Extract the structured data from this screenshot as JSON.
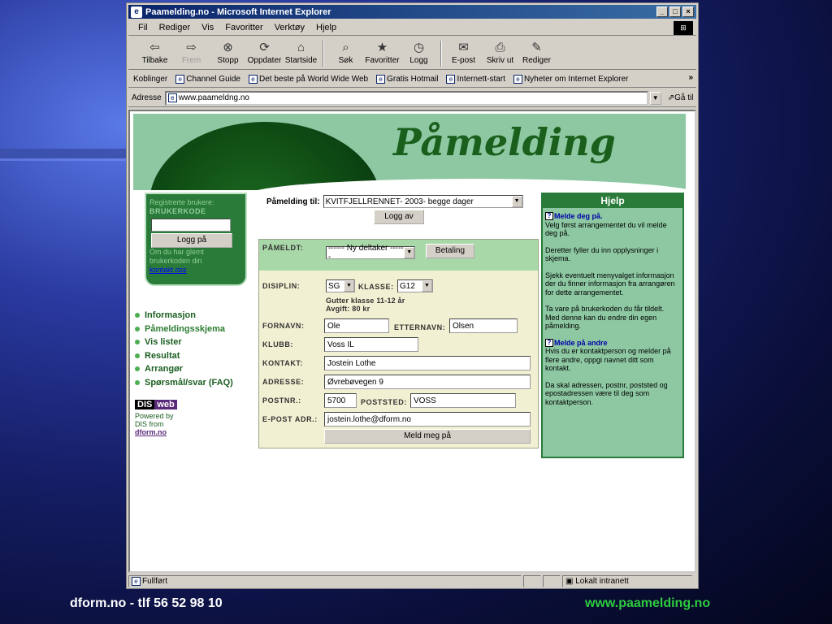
{
  "window": {
    "title": "Paamelding.no - Microsoft Internet Explorer",
    "buttons": [
      "_",
      "□",
      "×"
    ],
    "logo_icon": "windows-logo-icon"
  },
  "menu": [
    "Fil",
    "Rediger",
    "Vis",
    "Favoritter",
    "Verktøy",
    "Hjelp"
  ],
  "toolbar": {
    "back": "Tilbake",
    "forward": "Frem",
    "stop": "Stopp",
    "refresh": "Oppdater",
    "home": "Startside",
    "search": "Søk",
    "favorites": "Favoritter",
    "history": "Logg",
    "mail": "E-post",
    "print": "Skriv ut",
    "edit": "Rediger"
  },
  "links": {
    "label": "Koblinger",
    "items": [
      "Channel Guide",
      "Det beste på World Wide Web",
      "Gratis Hotmail",
      "Internett-start",
      "Nyheter om Internet Explorer"
    ]
  },
  "address": {
    "label": "Adresse",
    "value": "www.paameldng.no",
    "go": "Gå til"
  },
  "page": {
    "title": "Påmelding",
    "login": {
      "registered": "Registrerte brukere:",
      "code_label": "BRUKERKODE",
      "button": "Logg på",
      "forgot": "Om du har glemt brukerkoden din",
      "contact": "kontakt oss"
    },
    "nav": [
      "Informasjon",
      "Påmeldingsskjema",
      "Vis lister",
      "Resultat",
      "Arrangør",
      "Spørsmål/svar (FAQ)"
    ],
    "dis": {
      "logo_left": "DIS",
      "logo_right": "web",
      "powered": "Powered by",
      "from": "DIS from",
      "link": "dform.no"
    },
    "registration": {
      "label": "Påmelding til:",
      "event": "KVITFJELLRENNET- 2003- begge dager",
      "logout": "Logg av"
    },
    "form": {
      "pameldt_label": "PÅMELDT:",
      "pameldt_value": "------ Ny deltaker ------",
      "betaling": "Betaling",
      "disiplin_label": "DISIPLIN:",
      "disiplin_value": "SG",
      "klasse_label": "KLASSE:",
      "klasse_value": "G12",
      "class_desc": "Gutter klasse 11-12 år",
      "fee": "Avgift: 80 kr",
      "fornavn_label": "FORNAVN:",
      "fornavn_value": "Ole",
      "etternavn_label": "ETTERNAVN:",
      "etternavn_value": "Olsen",
      "klubb_label": "KLUBB:",
      "klubb_value": "Voss IL",
      "kontakt_label": "KONTAKT:",
      "kontakt_value": "Jostein Lothe",
      "adresse_label": "ADRESSE:",
      "adresse_value": "Øvrebøvegen 9",
      "postnr_label": "POSTNR.:",
      "postnr_value": "5700",
      "poststed_label": "POSTSTED:",
      "poststed_value": "VOSS",
      "epost_label": "E-POST ADR.:",
      "epost_value": "jostein.lothe@dform.no",
      "submit": "Meld meg på"
    },
    "help": {
      "title": "Hjelp",
      "s1_title": "Melde deg på.",
      "s1_p1": "Velg først arrangementet du vil melde deg på.",
      "s1_p2": "Deretter fyller du inn opplysninger i skjema.",
      "s1_p3": "Sjekk eventuelt menyvalget informasjon der du finner informasjon fra arrangøren for dette arrangementet.",
      "s1_p4": "Ta vare på brukerkoden du får tildelt. Med denne kan du endre din egen påmelding.",
      "s2_title": "Melde på andre",
      "s2_p1": "Hvis du er kontaktperson og melder på flere andre, oppgi navnet ditt som kontakt.",
      "s2_p2": "Da skal adressen, postnr, poststed og epostadressen være til deg som kontaktperson."
    }
  },
  "status": {
    "left": "Fullført",
    "zone": "Lokalt intranett"
  },
  "footer": {
    "left": "dform.no - tlf  56 52 98 10",
    "right": "www.paamelding.no"
  }
}
